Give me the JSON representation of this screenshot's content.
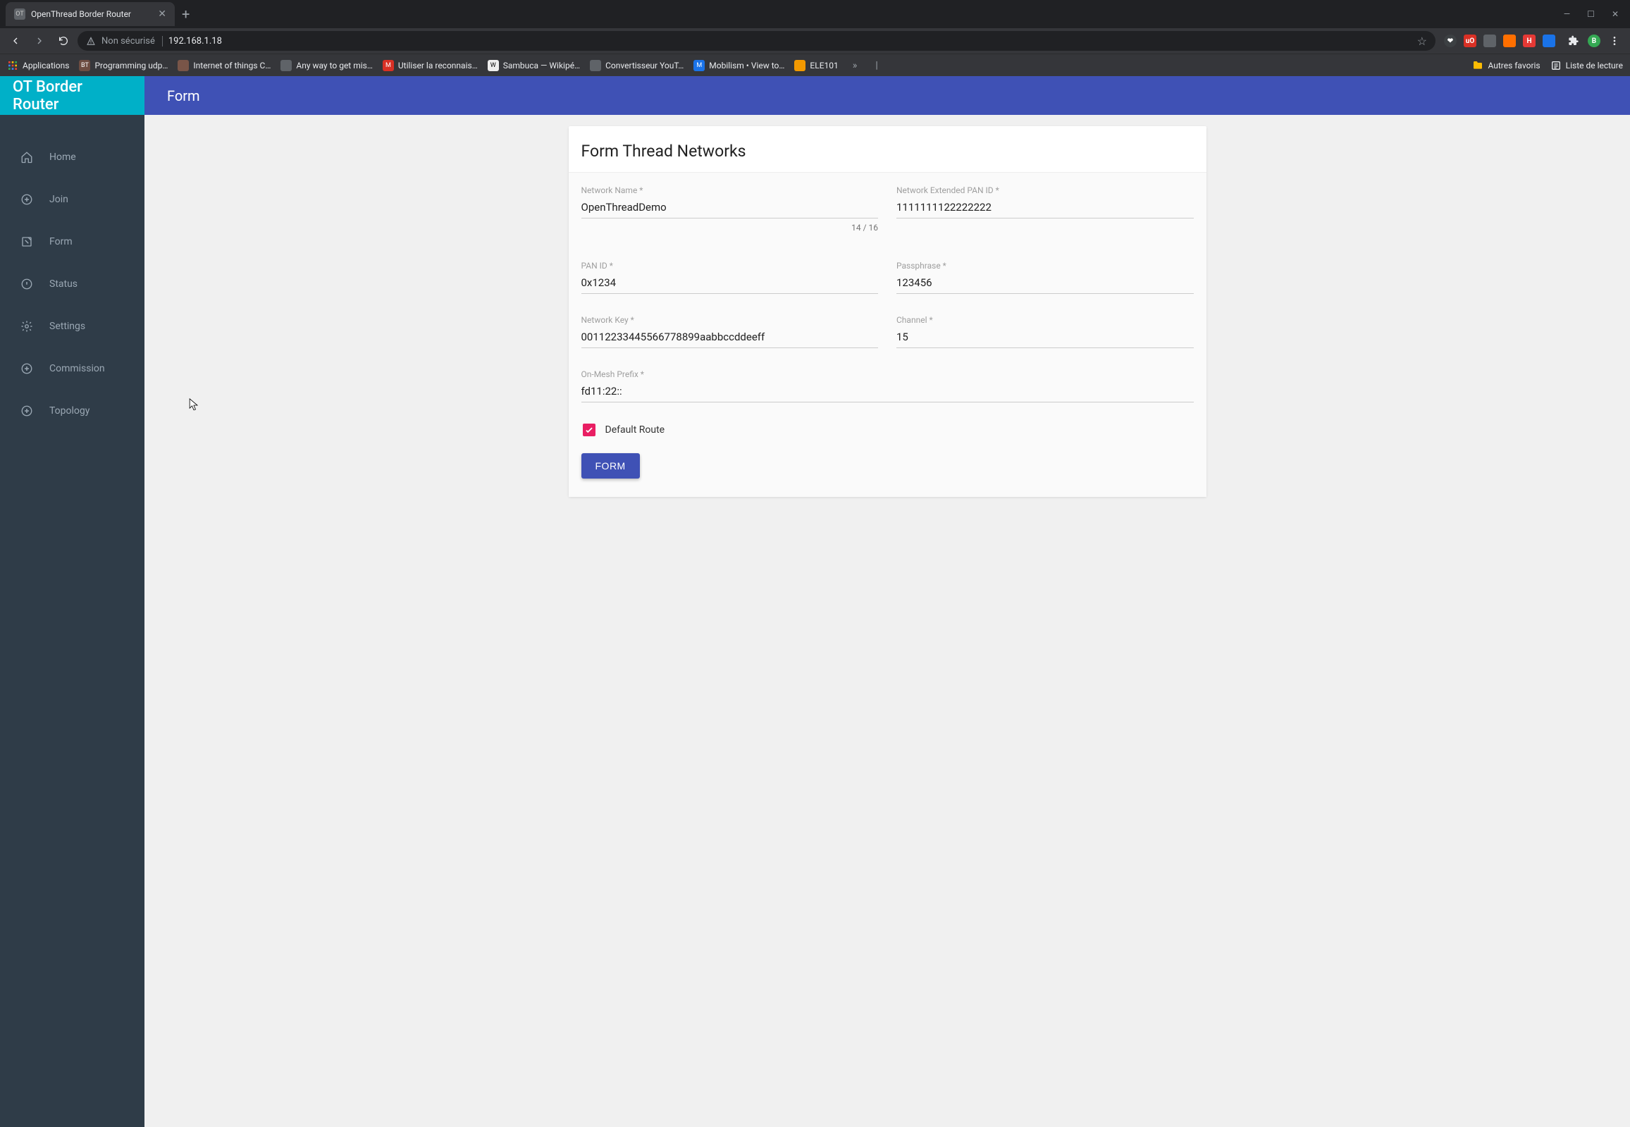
{
  "browser": {
    "tab_title": "OpenThread Border Router",
    "secure_label": "Non sécurisé",
    "url": "192.168.1.18",
    "bookmarks": [
      {
        "label": "Applications",
        "color": "linear"
      },
      {
        "label": "Programming udp…",
        "badge": "BT",
        "bg": "#6d4c41"
      },
      {
        "label": "Internet of things C…",
        "bg": "#795548"
      },
      {
        "label": "Any way to get mis…",
        "bg": "#5f6368"
      },
      {
        "label": "Utiliser la reconnais…",
        "badge": "M",
        "bg": "#d93025"
      },
      {
        "label": "Sambuca — Wikipé…",
        "badge": "W",
        "bg": "#eeeeee",
        "fg": "#000"
      },
      {
        "label": "Convertisseur YouT…",
        "bg": "#5f6368"
      },
      {
        "label": "Mobilism • View to…",
        "badge": "M",
        "bg": "#1a73e8"
      },
      {
        "label": "ELE101",
        "bg": "#f29900"
      }
    ],
    "overflow": "»",
    "right_bookmarks": [
      {
        "label": "Autres favoris",
        "icon": "folder"
      },
      {
        "label": "Liste de lecture",
        "icon": "list"
      }
    ]
  },
  "ext_icons": [
    {
      "bg": "#d93025",
      "txt": "uO"
    },
    {
      "bg": "#5f6368",
      "txt": ""
    },
    {
      "bg": "#ff6f00",
      "txt": ""
    },
    {
      "bg": "#e53935",
      "txt": "H"
    },
    {
      "bg": "#1a73e8",
      "txt": ""
    }
  ],
  "sidebar": {
    "brand": "OT Border Router",
    "items": [
      {
        "key": "home",
        "label": "Home"
      },
      {
        "key": "join",
        "label": "Join"
      },
      {
        "key": "form",
        "label": "Form"
      },
      {
        "key": "status",
        "label": "Status"
      },
      {
        "key": "settings",
        "label": "Settings"
      },
      {
        "key": "commission",
        "label": "Commission"
      },
      {
        "key": "topology",
        "label": "Topology"
      }
    ]
  },
  "topbar": {
    "title": "Form"
  },
  "page": {
    "title": "Form Thread Networks",
    "fields": {
      "network_name": {
        "label": "Network Name *",
        "value": "OpenThreadDemo",
        "counter": "14 / 16"
      },
      "ext_pan_id": {
        "label": "Network Extended PAN ID *",
        "value": "1111111122222222"
      },
      "pan_id": {
        "label": "PAN ID *",
        "value": "0x1234"
      },
      "passphrase": {
        "label": "Passphrase *",
        "value": "123456"
      },
      "network_key": {
        "label": "Network Key *",
        "value": "00112233445566778899aabbccddeeff"
      },
      "channel": {
        "label": "Channel *",
        "value": "15"
      },
      "prefix": {
        "label": "On-Mesh Prefix *",
        "value": "fd11:22::"
      }
    },
    "default_route_label": "Default Route",
    "submit_label": "FORM"
  }
}
